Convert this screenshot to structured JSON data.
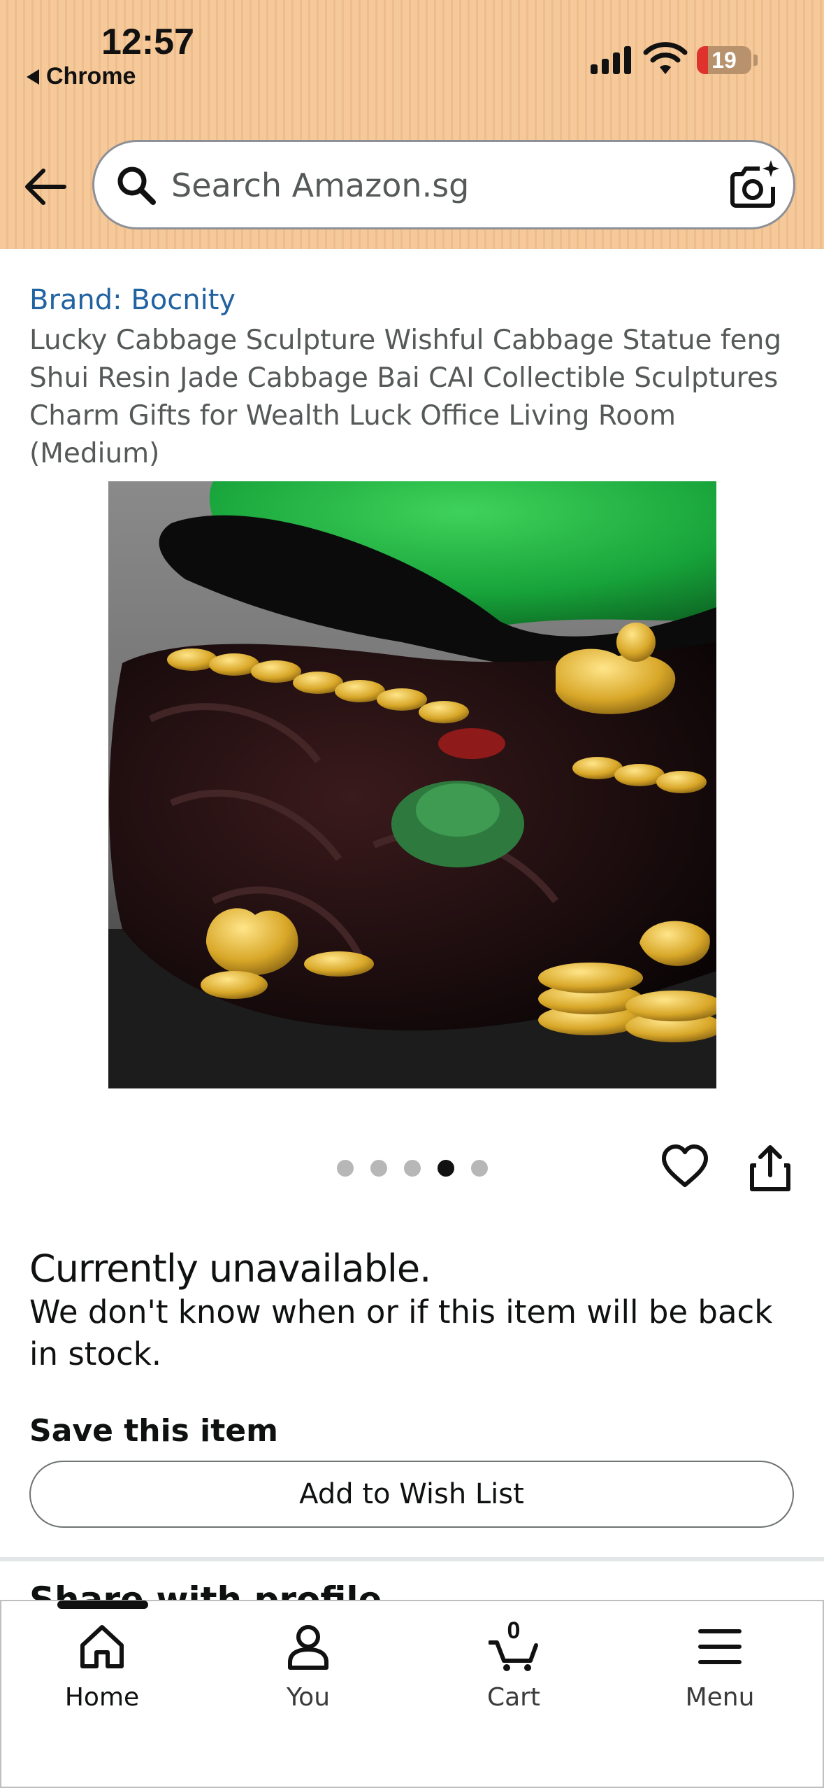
{
  "status_bar": {
    "time": "12:57",
    "back_app": "Chrome",
    "battery": "19"
  },
  "search": {
    "placeholder": "Search Amazon.sg"
  },
  "product": {
    "brand": "Brand: Bocnity",
    "title": "Lucky Cabbage Sculpture Wishful Cabbage Statue feng Shui Resin Jade Cabbage Bai CAI Collectible Sculptures Charm Gifts for Wealth Luck Office Living Room (Medium)",
    "image_dots": {
      "count": 5,
      "active_index": 3
    }
  },
  "availability": {
    "heading": "Currently unavailable.",
    "description": "We don't know when or if this item will be back in stock."
  },
  "save": {
    "heading": "Save this item",
    "button_label": "Add to Wish List"
  },
  "next_section_peek": "Share with profile",
  "bottom_nav": {
    "items": [
      {
        "label": "Home",
        "icon": "home-icon",
        "active": true
      },
      {
        "label": "You",
        "icon": "person-icon",
        "active": false
      },
      {
        "label": "Cart",
        "icon": "cart-icon",
        "active": false,
        "count": "0"
      },
      {
        "label": "Menu",
        "icon": "menu-icon",
        "active": false
      }
    ]
  },
  "colors": {
    "header_bg": "#f5c99a",
    "link": "#2162a1",
    "text": "#0f1111",
    "secondary_text": "#565959"
  }
}
